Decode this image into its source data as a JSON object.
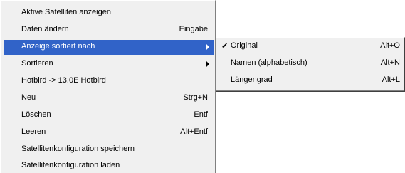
{
  "menu": {
    "items": [
      {
        "label": "Aktive Satelliten anzeigen",
        "shortcut": ""
      },
      {
        "label": "Daten ändern",
        "shortcut": "Eingabe"
      },
      {
        "label": "Anzeige sortiert nach",
        "shortcut": "",
        "submenu_icon": "submenu-arrow-icon",
        "selected": true
      },
      {
        "label": "Sortieren",
        "shortcut": "",
        "submenu_icon": "submenu-arrow-icon"
      },
      {
        "label": "Hotbird -> 13.0E Hotbird",
        "shortcut": ""
      },
      {
        "label": "Neu",
        "shortcut": "Strg+N"
      },
      {
        "label": "Löschen",
        "shortcut": "Entf"
      },
      {
        "label": "Leeren",
        "shortcut": "Alt+Entf"
      },
      {
        "label": "Satellitenkonfiguration speichern",
        "shortcut": ""
      },
      {
        "label": "Satellitenkonfiguration laden",
        "shortcut": ""
      }
    ]
  },
  "submenu": {
    "items": [
      {
        "label": "Original",
        "shortcut": "Alt+O",
        "checked": true,
        "check_glyph": "✔"
      },
      {
        "label": "Namen (alphabetisch)",
        "shortcut": "Alt+N",
        "checked": false
      },
      {
        "label": "Längengrad",
        "shortcut": "Alt+L",
        "checked": false
      }
    ]
  },
  "colors": {
    "menu_background": "#f0f0f0",
    "highlight": "#3163c8",
    "highlight_text": "#ffffff"
  }
}
